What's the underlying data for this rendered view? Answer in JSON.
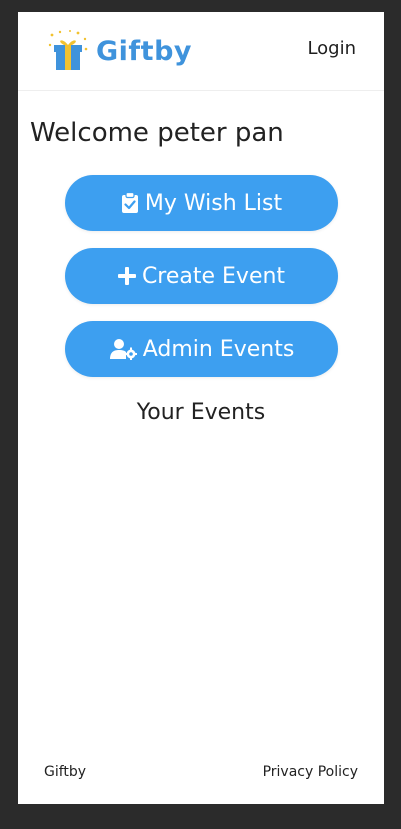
{
  "brand": {
    "name": "Giftby",
    "color": "#3f93dc"
  },
  "header": {
    "login_label": "Login"
  },
  "welcome": {
    "text": "Welcome peter pan"
  },
  "actions": {
    "wishlist_label": "My Wish List",
    "create_label": "Create Event",
    "admin_label": "Admin Events",
    "button_color": "#3d9ff0"
  },
  "icons": {
    "logo": "gift-icon",
    "wishlist": "clipboard-check-icon",
    "create": "plus-icon",
    "admin": "user-gear-icon"
  },
  "events": {
    "heading": "Your Events"
  },
  "footer": {
    "brand": "Giftby",
    "privacy_label": "Privacy Policy"
  }
}
